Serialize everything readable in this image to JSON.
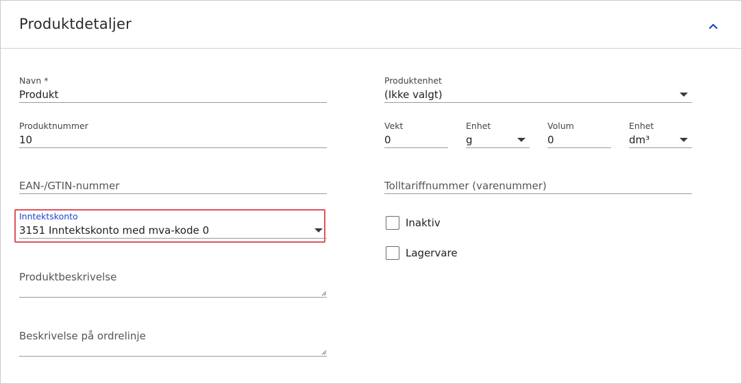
{
  "header": {
    "title": "Produktdetaljer",
    "collapse_icon": "chevron-up-icon"
  },
  "left": {
    "navn": {
      "label": "Navn *",
      "value": "Produkt"
    },
    "produktnummer": {
      "label": "Produktnummer",
      "value": "10"
    },
    "ean": {
      "placeholder": "EAN-/GTIN-nummer"
    },
    "inntektskonto": {
      "label": "Inntektskonto",
      "value": "3151 Inntektskonto med mva-kode 0"
    },
    "produktbeskrivelse": {
      "placeholder": "Produktbeskrivelse"
    },
    "ordrelinje": {
      "placeholder": "Beskrivelse på ordrelinje"
    }
  },
  "right": {
    "produktenhet": {
      "label": "Produktenhet",
      "value": "(Ikke valgt)"
    },
    "vekt": {
      "label": "Vekt",
      "value": "0"
    },
    "vekt_enhet": {
      "label": "Enhet",
      "value": "g"
    },
    "volum": {
      "label": "Volum",
      "value": "0"
    },
    "volum_enhet": {
      "label": "Enhet",
      "value": "dm³"
    },
    "tolltariff": {
      "placeholder": "Tolltariffnummer (varenummer)"
    },
    "inaktiv": {
      "label": "Inaktiv",
      "checked": false
    },
    "lagervare": {
      "label": "Lagervare",
      "checked": false
    }
  },
  "colors": {
    "accent": "#1a47c9",
    "highlight": "#e0505a"
  }
}
